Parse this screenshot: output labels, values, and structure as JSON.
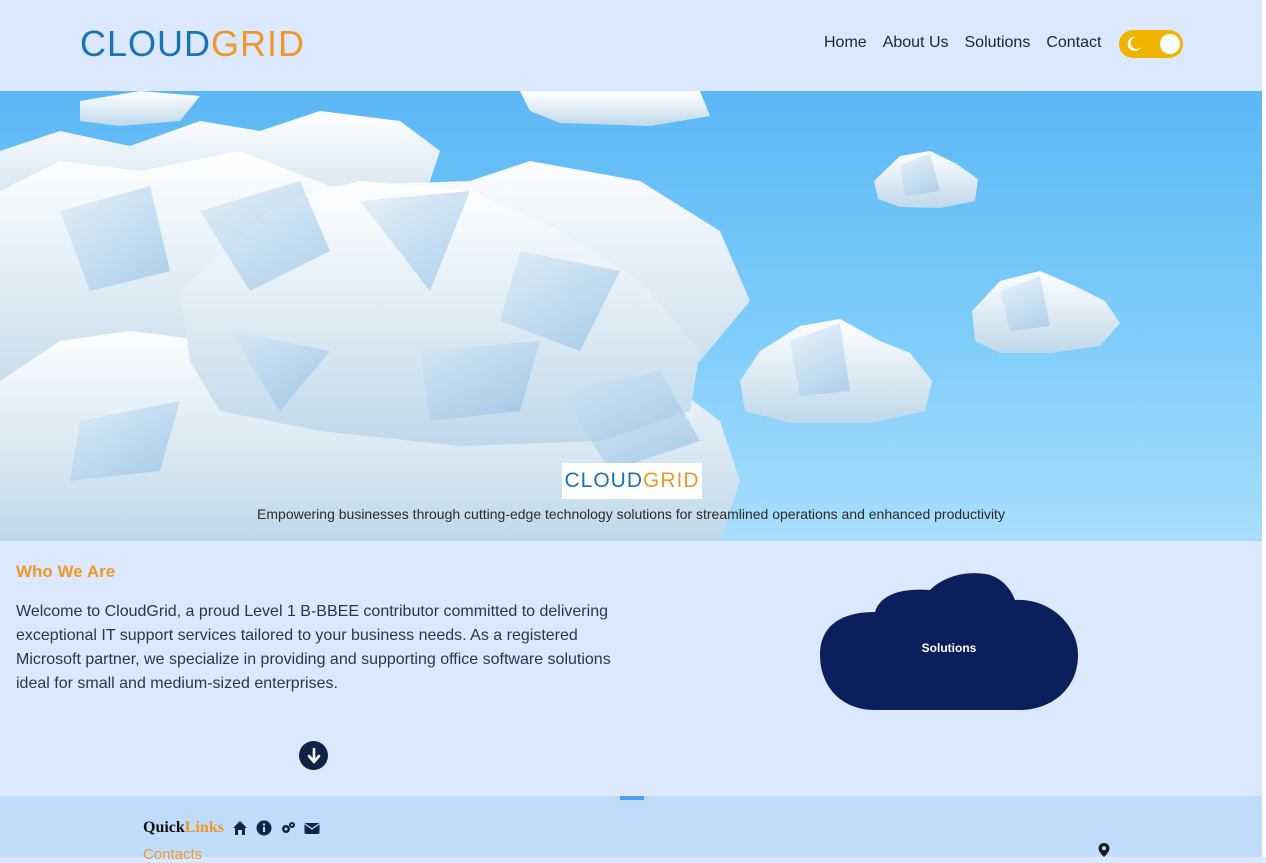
{
  "brand": {
    "name_part1": "CLOUD",
    "name_part2": "GRID"
  },
  "nav": {
    "items": [
      "Home",
      "About Us",
      "Solutions",
      "Contact"
    ]
  },
  "theme_toggle": {
    "state": "dark-mode-toggle",
    "accent": "#f0b400"
  },
  "hero": {
    "logo_part1": "CLOUD",
    "logo_part2": "GRID",
    "tagline": "Empowering businesses through cutting-edge technology solutions for streamlined operations and enhanced productivity"
  },
  "who": {
    "title": "Who We Are",
    "text": "Welcome to CloudGrid, a proud Level 1 B-BBEE contributor committed to delivering exceptional IT support services tailored to your business needs. As a registered Microsoft partner, we specialize in providing and supporting office software solutions ideal for small and medium-sized enterprises."
  },
  "solutions_cloud": {
    "label": "Solutions",
    "color": "#0b1f5c"
  },
  "footer": {
    "quick": "Quick",
    "links": "Links",
    "contacts_label": "Contacts",
    "icons": [
      "home-icon",
      "info-icon",
      "cogs-icon",
      "envelope-icon"
    ]
  },
  "colors": {
    "orange": "#f0972a",
    "blue": "#1b73b6",
    "navy": "#0b1f5c"
  }
}
